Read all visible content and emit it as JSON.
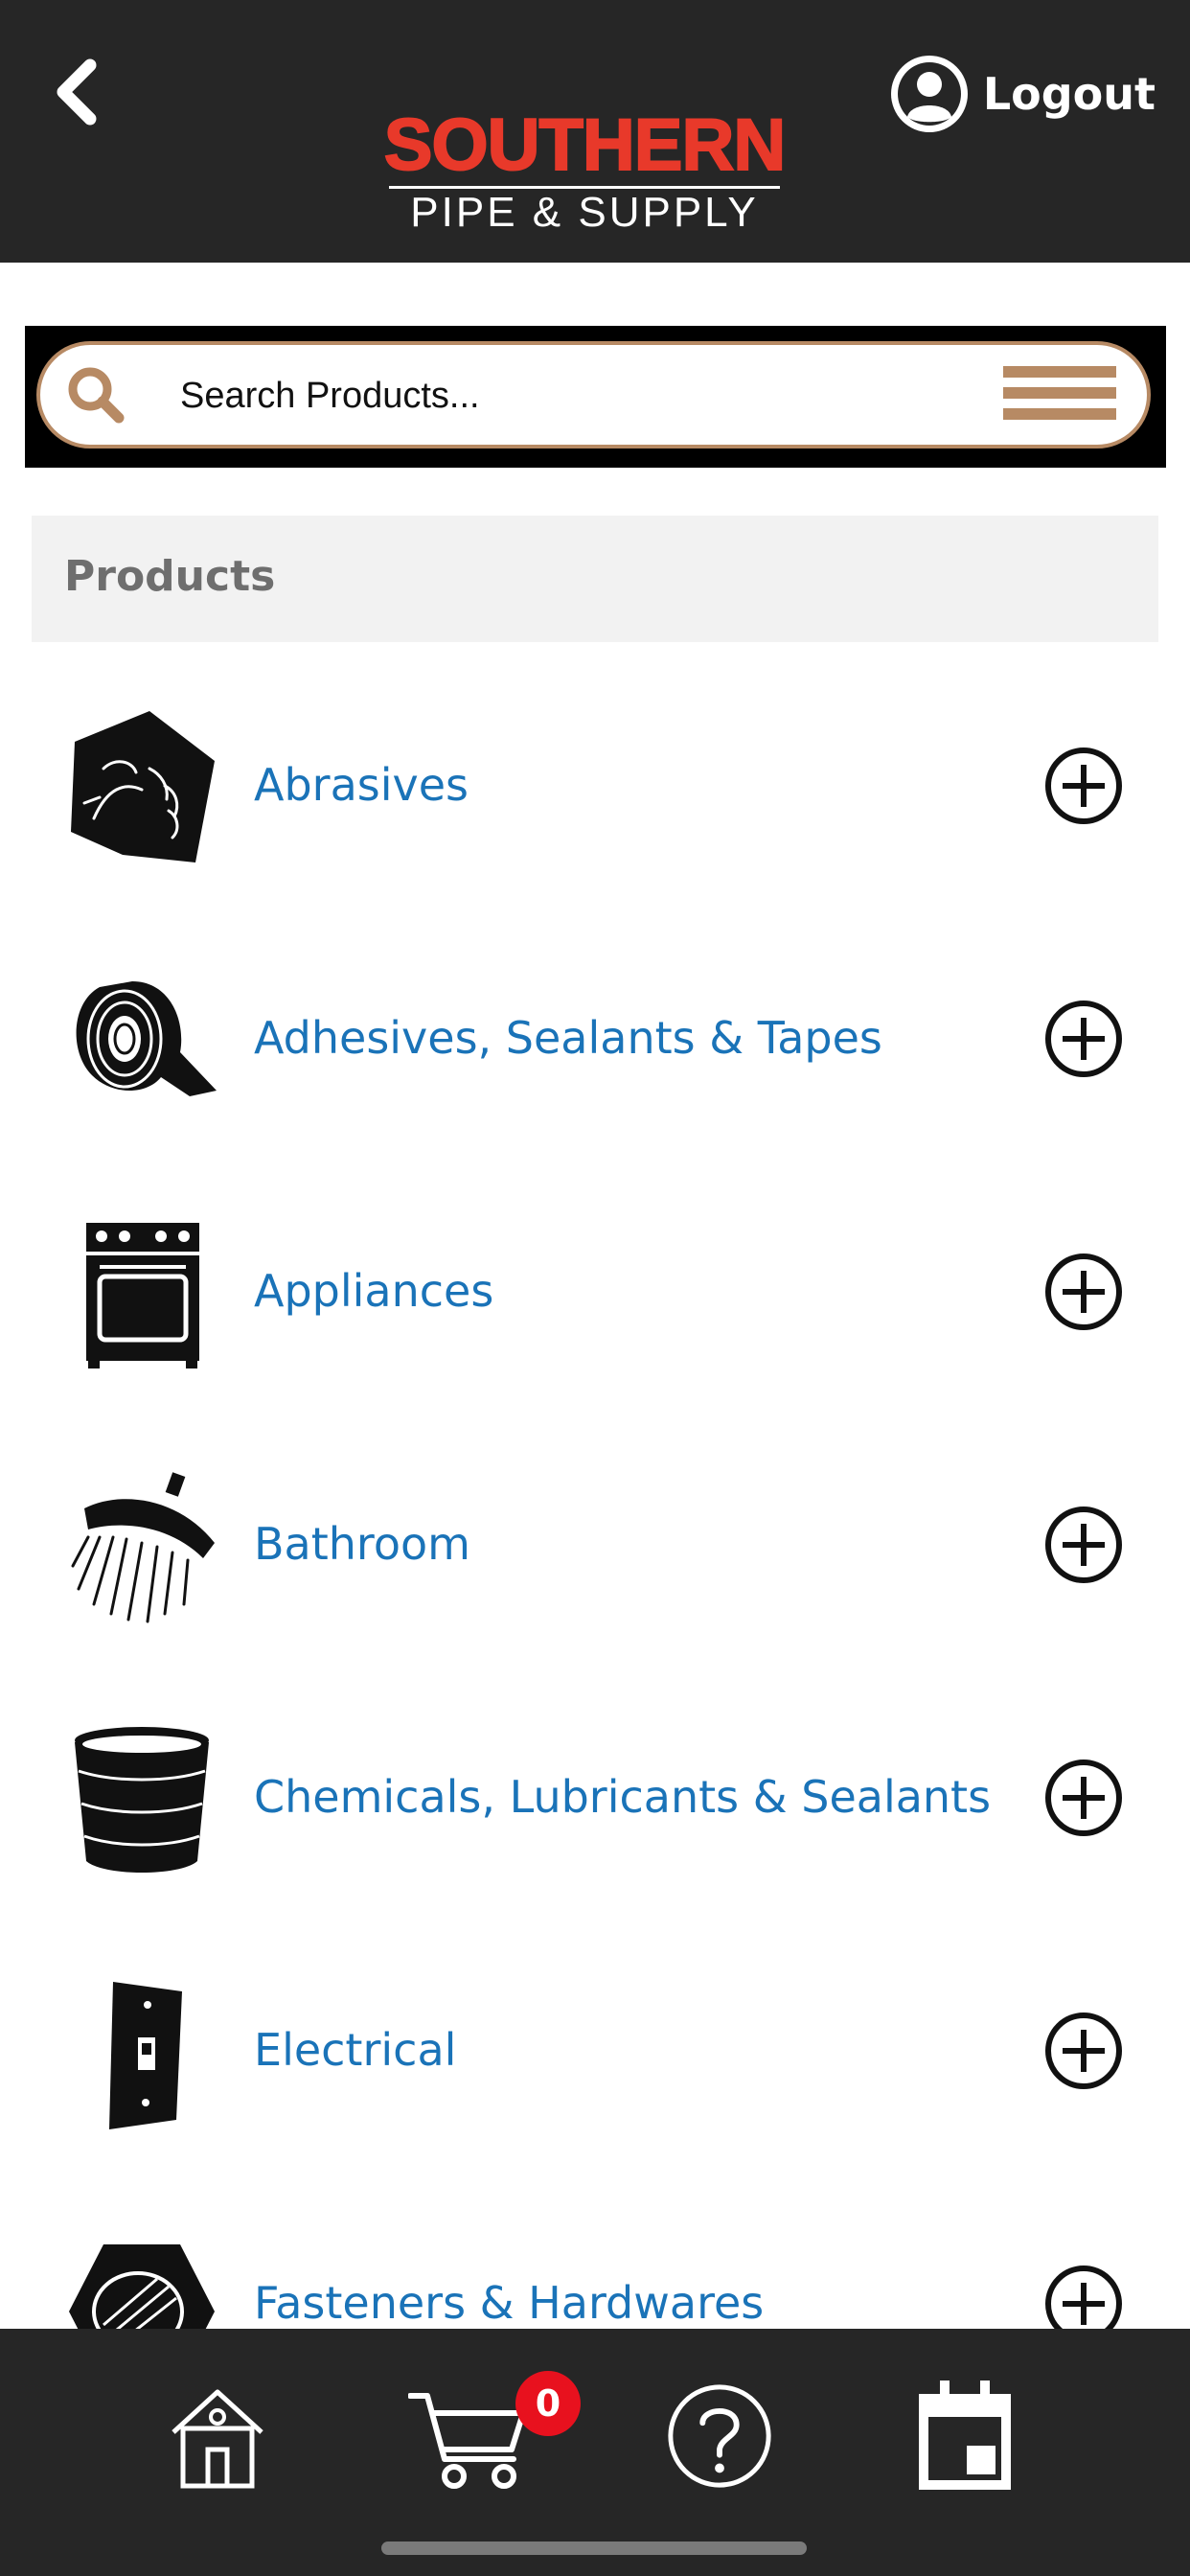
{
  "header": {
    "logo_top": "SOUTHERN",
    "logo_bottom": "PIPE & SUPPLY",
    "logout_label": "Logout"
  },
  "search": {
    "placeholder": "Search Products..."
  },
  "section": {
    "title": "Products"
  },
  "products": [
    {
      "label": "Abrasives",
      "icon": "sandpaper-icon"
    },
    {
      "label": "Adhesives, Sealants & Tapes",
      "icon": "tape-roll-icon"
    },
    {
      "label": "Appliances",
      "icon": "stove-icon"
    },
    {
      "label": "Bathroom",
      "icon": "shower-head-icon"
    },
    {
      "label": "Chemicals, Lubricants & Sealants",
      "icon": "bucket-icon"
    },
    {
      "label": "Electrical",
      "icon": "light-switch-icon"
    },
    {
      "label": "Fasteners & Hardwares",
      "icon": "nut-icon"
    }
  ],
  "bottom_nav": {
    "cart_count": "0",
    "items": [
      "home-icon",
      "cart-icon",
      "help-icon",
      "calendar-icon"
    ]
  },
  "colors": {
    "header_bg": "#262626",
    "accent_tan": "#b78a64",
    "link_blue": "#1a73b8",
    "logo_red": "#e8392a",
    "badge_red": "#e8111e"
  }
}
